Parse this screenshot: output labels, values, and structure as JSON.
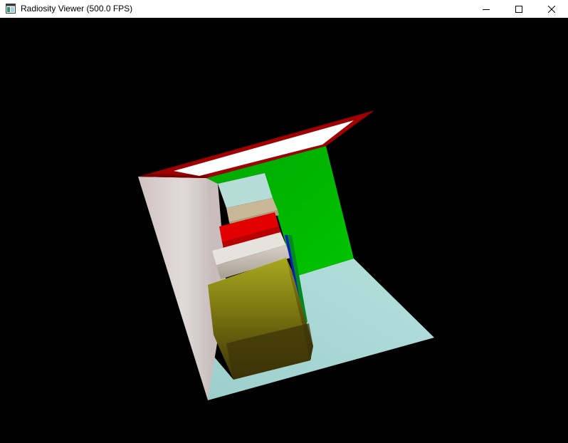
{
  "window": {
    "title": "Radiosity Viewer  (500.0 FPS)",
    "icon": "app-window-icon"
  },
  "controls": {
    "minimize_icon": "minimize-icon",
    "maximize_icon": "maximize-icon",
    "close_icon": "close-icon"
  },
  "scene": {
    "description_colors": {
      "background": "#000000",
      "left_wall": "#d8cfcf",
      "back_wall": "#00b800",
      "floor": "#a8d8d4",
      "ceiling_light": "#ffffff",
      "ceiling_frame": "#a00000",
      "tall_box_front": "#8a8a10",
      "tall_box_top": "#e6e600",
      "short_box_top": "#e0dcd8",
      "red_box": "#e00000",
      "tan_box": "#c8b898"
    }
  }
}
